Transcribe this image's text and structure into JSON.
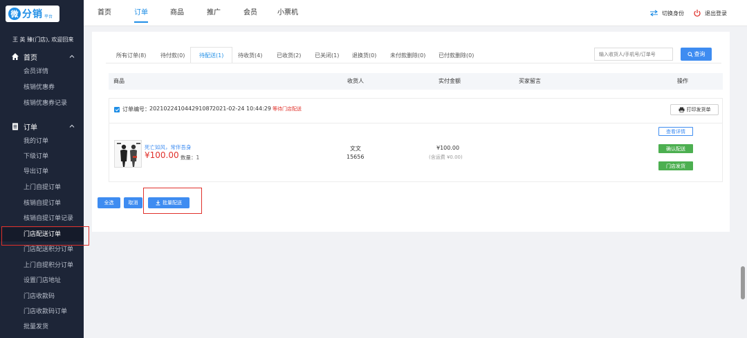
{
  "logo": {
    "mark": "微",
    "text": "分销",
    "sub": "平台"
  },
  "sidebar": {
    "welcome": "王 英 臻(门店), 欢迎回来",
    "groups": [
      {
        "label": "首页",
        "items": [
          "会员详情",
          "核销优惠券",
          "核销优惠券记录"
        ]
      },
      {
        "label": "订单",
        "items": [
          "我的订单",
          "下级订单",
          "导出订单",
          "上门自提订单",
          "核销自提订单",
          "核销自提订单记录",
          "门店配送订单",
          "门店配送积分订单",
          "上门自提积分订单",
          "设置门店地址",
          "门店收款码",
          "门店收款码订单",
          "批量发货"
        ]
      }
    ],
    "active_item": "门店配送订单"
  },
  "topbar": {
    "tabs": [
      "首页",
      "订单",
      "商品",
      "推广",
      "会员",
      "小票机"
    ],
    "active_tab": "订单",
    "switch_identity": "切换身份",
    "logout": "退出登录"
  },
  "status_tabs": [
    "所有订单(8)",
    "待付款(0)",
    "待配送(1)",
    "待收货(4)",
    "已收货(2)",
    "已关闭(1)",
    "退换货(0)",
    "未付款删除(0)",
    "已付款删除(0)"
  ],
  "active_status": "待配送(1)",
  "search": {
    "placeholder": "输入收货人/手机号/订单号",
    "button": "查询"
  },
  "table": {
    "headers": [
      "商品",
      "收货人",
      "实付金额",
      "买家留言",
      "操作"
    ]
  },
  "order": {
    "number_label": "订单编号：",
    "number": "2021022410442910​87",
    "time": "2021-02-24 10:44:29",
    "tag": "等待门店配送",
    "print_btn": "打印发货单",
    "product_name": "死亡如风，常伴吾身",
    "product_price": "¥100.00",
    "quantity": "数量：1",
    "receiver_name": "文文",
    "receiver_id": "15656",
    "amount": "¥100.00",
    "shipping": "(含运费 ¥0.00)",
    "actions": {
      "view": "查看详情",
      "confirm": "确认配送",
      "store_ship": "门店发货"
    }
  },
  "bottom": {
    "select_all": "全选",
    "cancel": "取消",
    "batch": "批量配送"
  },
  "colors": {
    "accent": "#1f8ee6",
    "button": "#3e8cf1",
    "green": "#4caf50",
    "danger": "#e0302a",
    "sidebar": "#1d2537"
  }
}
